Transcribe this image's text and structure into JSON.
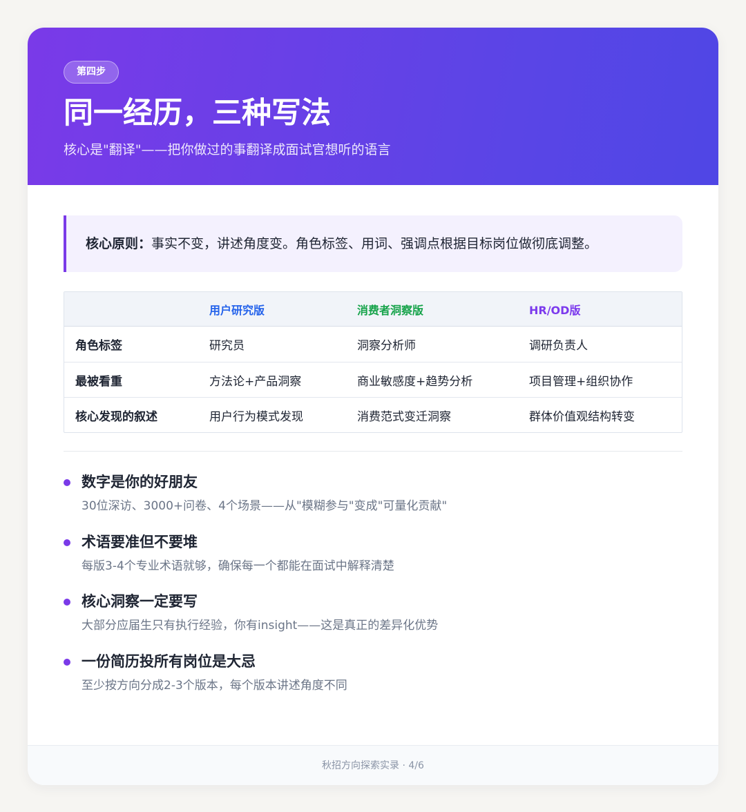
{
  "header": {
    "step": "第四步",
    "title": "同一经历，三种写法",
    "subtitle": "核心是\"翻译\"——把你做过的事翻译成面试官想听的语言"
  },
  "callout": {
    "label": "核心原则：",
    "text": "事实不变，讲述角度变。角色标签、用词、强调点根据目标岗位做彻底调整。"
  },
  "table": {
    "columns": [
      "",
      "用户研究版",
      "消费者洞察版",
      "HR/OD版"
    ],
    "rows": [
      [
        "角色标签",
        "研究员",
        "洞察分析师",
        "调研负责人"
      ],
      [
        "最被看重",
        "方法论+产品洞察",
        "商业敏感度+趋势分析",
        "项目管理+组织协作"
      ],
      [
        "核心发现的叙述",
        "用户行为模式发现",
        "消费范式变迁洞察",
        "群体价值观结构转变"
      ]
    ],
    "column_colors": [
      "#1f2533",
      "#2563eb",
      "#16a34a",
      "#7c3aed"
    ]
  },
  "tips": [
    {
      "title": "数字是你的好朋友",
      "desc": "30位深访、3000+问卷、4个场景——从\"模糊参与\"变成\"可量化贡献\""
    },
    {
      "title": "术语要准但不要堆",
      "desc": "每版3-4个专业术语就够，确保每一个都能在面试中解释清楚"
    },
    {
      "title": "核心洞察一定要写",
      "desc": "大部分应届生只有执行经验，你有insight——这是真正的差异化优势"
    },
    {
      "title": "一份简历投所有岗位是大忌",
      "desc": "至少按方向分成2-3个版本，每个版本讲述角度不同"
    }
  ],
  "footer": {
    "text": "秋招方向探索实录 · 4/6"
  },
  "colors": {
    "accent": "#7a3ae8",
    "header_gradient_end": "#4f46e5"
  }
}
